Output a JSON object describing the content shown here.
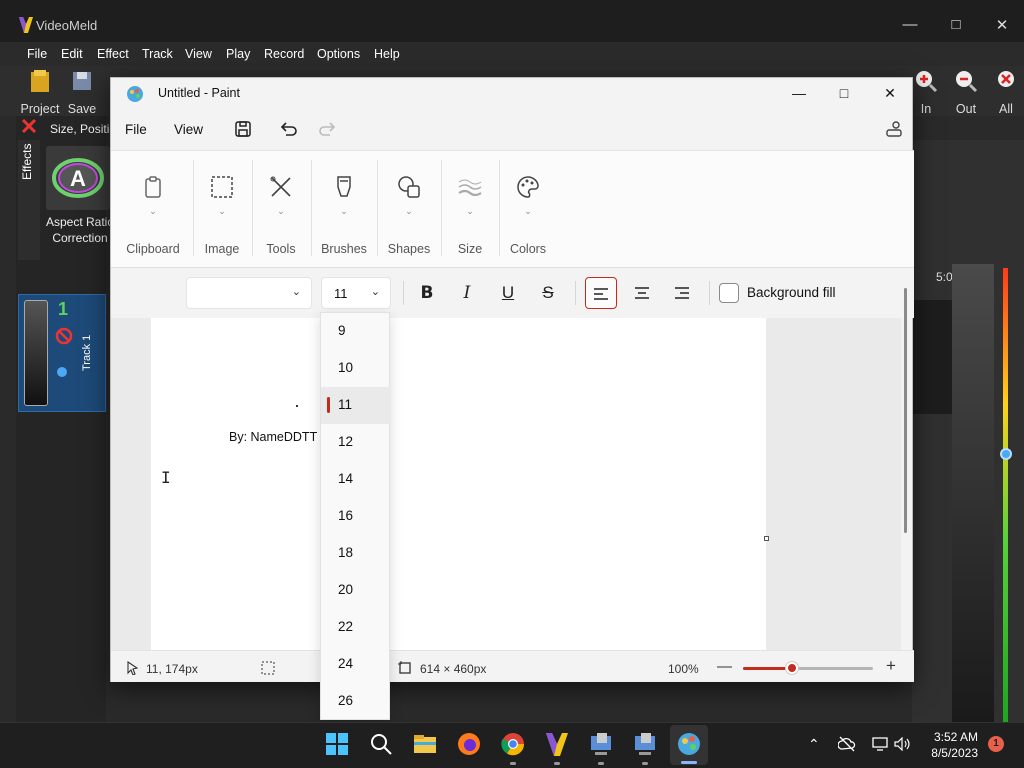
{
  "videomeld": {
    "title": "VideoMeld",
    "menu": [
      {
        "label": "File"
      },
      {
        "label": "Edit"
      },
      {
        "label": "Effect"
      },
      {
        "label": "Track"
      },
      {
        "label": "View"
      },
      {
        "label": "Play"
      },
      {
        "label": "Record"
      },
      {
        "label": "Options"
      },
      {
        "label": "Help"
      }
    ],
    "toolbar": {
      "project": "Project",
      "save": "Save",
      "zoom_in": "In",
      "zoom_out": "Out",
      "zoom_all": "All"
    },
    "left_panel": {
      "tab": "Effects",
      "header": "Size, Positio",
      "effect_name": "Aspect Ratio Correction"
    },
    "track": {
      "number": "1",
      "label": "Track 1"
    },
    "timeline_time": "5:0"
  },
  "paint": {
    "title": "Untitled - Paint",
    "menu": {
      "file": "File",
      "view": "View"
    },
    "ribbon": [
      {
        "label": "Clipboard",
        "icon": "clipboard-icon"
      },
      {
        "label": "Image",
        "icon": "selection-icon"
      },
      {
        "label": "Tools",
        "icon": "tools-icon"
      },
      {
        "label": "Brushes",
        "icon": "brush-icon"
      },
      {
        "label": "Shapes",
        "icon": "shapes-icon"
      },
      {
        "label": "Size",
        "icon": "line-size-icon"
      },
      {
        "label": "Colors",
        "icon": "palette-icon"
      }
    ],
    "text_toolbar": {
      "font_value": "",
      "size_value": "11",
      "background_fill_label": "Background fill",
      "background_fill_checked": false,
      "alignment": "left"
    },
    "font_size_options": [
      "9",
      "10",
      "11",
      "12",
      "14",
      "16",
      "18",
      "20",
      "22",
      "24",
      "26"
    ],
    "selected_size": "11",
    "canvas_text": "By: NameDDTT",
    "status": {
      "cursor_pos": "11, 174px",
      "canvas_size": "614 × 460px",
      "zoom": "100%",
      "zoom_fraction": 0.38
    },
    "accent": "#c42b1c"
  },
  "taskbar": {
    "time": "3:52 AM",
    "date": "8/5/2023",
    "notifications": "1"
  }
}
